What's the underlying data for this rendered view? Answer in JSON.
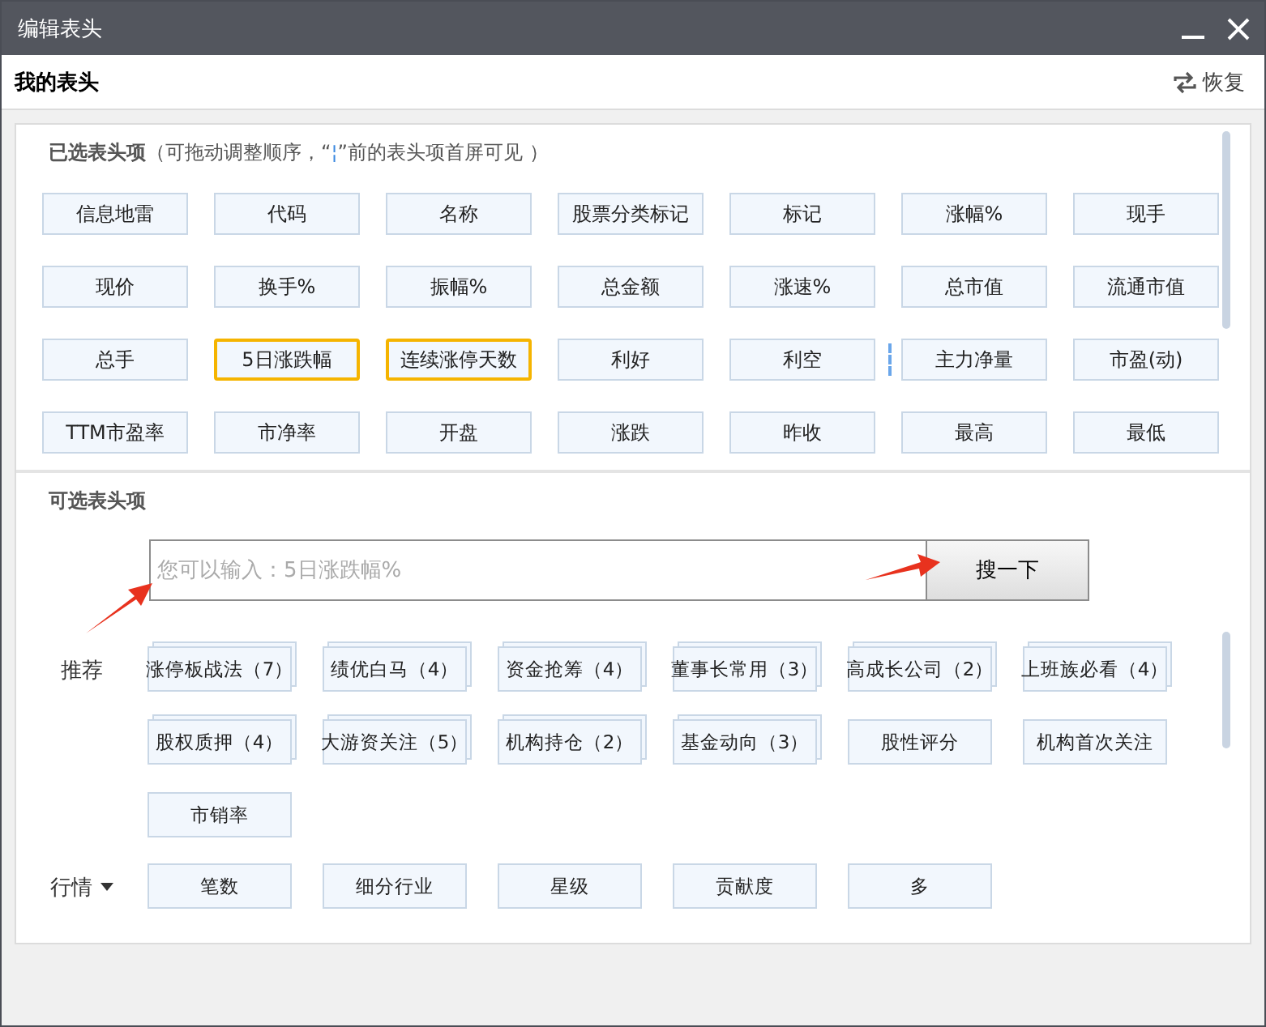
{
  "window": {
    "title": "编辑表头"
  },
  "header": {
    "title": "我的表头",
    "restore": "恢复"
  },
  "selected_panel": {
    "title": "已选表头项",
    "hint": "（可拖动调整顺序，“",
    "marker": "¦",
    "hint_end": "”前的表头项首屏可见 ）",
    "items": [
      {
        "label": "信息地雷",
        "selected": false,
        "marker_after": false
      },
      {
        "label": "代码",
        "selected": false,
        "marker_after": false
      },
      {
        "label": "名称",
        "selected": false,
        "marker_after": false
      },
      {
        "label": "股票分类标记",
        "selected": false,
        "marker_after": false
      },
      {
        "label": "标记",
        "selected": false,
        "marker_after": false
      },
      {
        "label": "涨幅%",
        "selected": false,
        "marker_after": false
      },
      {
        "label": "现手",
        "selected": false,
        "marker_after": false
      },
      {
        "label": "现价",
        "selected": false,
        "marker_after": false
      },
      {
        "label": "换手%",
        "selected": false,
        "marker_after": false
      },
      {
        "label": "振幅%",
        "selected": false,
        "marker_after": false
      },
      {
        "label": "总金额",
        "selected": false,
        "marker_after": false
      },
      {
        "label": "涨速%",
        "selected": false,
        "marker_after": false
      },
      {
        "label": "总市值",
        "selected": false,
        "marker_after": false
      },
      {
        "label": "流通市值",
        "selected": false,
        "marker_after": false
      },
      {
        "label": "总手",
        "selected": false,
        "marker_after": false
      },
      {
        "label": "5日涨跌幅",
        "selected": true,
        "marker_after": false
      },
      {
        "label": "连续涨停天数",
        "selected": true,
        "marker_after": false
      },
      {
        "label": "利好",
        "selected": false,
        "marker_after": false
      },
      {
        "label": "利空",
        "selected": false,
        "marker_after": true
      },
      {
        "label": "主力净量",
        "selected": false,
        "marker_after": false
      },
      {
        "label": "市盈(动)",
        "selected": false,
        "marker_after": false
      },
      {
        "label": "TTM市盈率",
        "selected": false,
        "marker_after": false
      },
      {
        "label": "市净率",
        "selected": false,
        "marker_after": false
      },
      {
        "label": "开盘",
        "selected": false,
        "marker_after": false
      },
      {
        "label": "涨跌",
        "selected": false,
        "marker_after": false
      },
      {
        "label": "昨收",
        "selected": false,
        "marker_after": false
      },
      {
        "label": "最高",
        "selected": false,
        "marker_after": false
      },
      {
        "label": "最低",
        "selected": false,
        "marker_after": false
      }
    ]
  },
  "optional_panel": {
    "title": "可选表头项",
    "search": {
      "placeholder": "您可以输入：5日涨跌幅%",
      "button": "搜一下"
    },
    "groups": [
      {
        "label": "推荐",
        "dropdown": false,
        "items": [
          {
            "label": "涨停板战法（7）",
            "kind": "stack"
          },
          {
            "label": "绩优白马（4）",
            "kind": "stack"
          },
          {
            "label": "资金抢筹（4）",
            "kind": "stack"
          },
          {
            "label": "董事长常用（3）",
            "kind": "stack"
          },
          {
            "label": "高成长公司（2）",
            "kind": "stack"
          },
          {
            "label": "上班族必看（4）",
            "kind": "stack"
          },
          {
            "label": "股权质押（4）",
            "kind": "stack"
          },
          {
            "label": "大游资关注（5）",
            "kind": "stack"
          },
          {
            "label": "机构持仓（2）",
            "kind": "stack"
          },
          {
            "label": "基金动向（3）",
            "kind": "stack"
          },
          {
            "label": "股性评分",
            "kind": "single"
          },
          {
            "label": "机构首次关注",
            "kind": "single"
          },
          {
            "label": "市销率",
            "kind": "single"
          }
        ]
      },
      {
        "label": "行情",
        "dropdown": true,
        "items": [
          {
            "label": "笔数",
            "kind": "single"
          },
          {
            "label": "细分行业",
            "kind": "single"
          },
          {
            "label": "星级",
            "kind": "single"
          },
          {
            "label": "贡献度",
            "kind": "single"
          },
          {
            "label": "多",
            "kind": "single"
          }
        ]
      }
    ]
  }
}
